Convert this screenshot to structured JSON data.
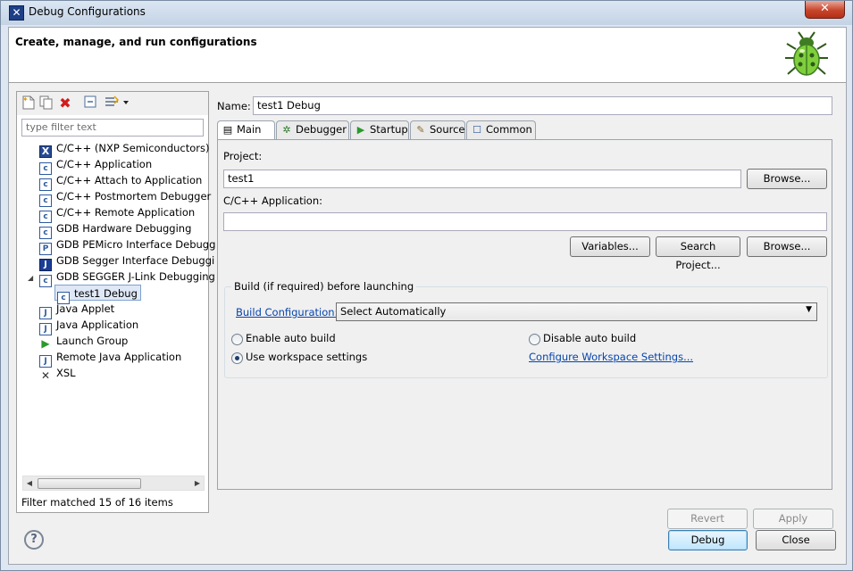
{
  "window": {
    "title": "Debug Configurations",
    "close_glyph": "✕"
  },
  "header": {
    "title": "Create, manage, and run configurations"
  },
  "left_panel": {
    "toolbar_icons": [
      "new-configuration-icon",
      "duplicate-icon",
      "delete-icon",
      "collapse-all-icon",
      "filter-icon"
    ],
    "filter_placeholder": "type filter text",
    "tree": [
      {
        "label": "C/C++ (NXP Semiconductors)",
        "icon": "X",
        "level": 0
      },
      {
        "label": "C/C++ Application",
        "icon": "c",
        "level": 0
      },
      {
        "label": "C/C++ Attach to Application",
        "icon": "c",
        "level": 0
      },
      {
        "label": "C/C++ Postmortem Debugger",
        "icon": "c",
        "level": 0
      },
      {
        "label": "C/C++ Remote Application",
        "icon": "c",
        "level": 0
      },
      {
        "label": "GDB Hardware Debugging",
        "icon": "c",
        "level": 0
      },
      {
        "label": "GDB PEMicro Interface Debugg",
        "icon": "P",
        "level": 0
      },
      {
        "label": "GDB Segger Interface Debuggi",
        "icon": "J",
        "level": 0
      },
      {
        "label": "GDB SEGGER J-Link Debugging",
        "icon": "c",
        "level": 0,
        "expanded": true
      },
      {
        "label": "test1 Debug",
        "icon": "c",
        "level": 1,
        "selected": true
      },
      {
        "label": "Java Applet",
        "icon": "J",
        "level": 0
      },
      {
        "label": "Java Application",
        "icon": "J",
        "level": 0
      },
      {
        "label": "Launch Group",
        "icon": "▶",
        "level": 0
      },
      {
        "label": "Remote Java Application",
        "icon": "J",
        "level": 0
      },
      {
        "label": "XSL",
        "icon": "✕",
        "level": 0
      }
    ],
    "expand_glyph": "◢",
    "status": "Filter matched 15 of 16 items",
    "scroll_left": "◀",
    "scroll_right": "▶"
  },
  "config": {
    "name_label": "Name:",
    "name_value": "test1 Debug",
    "tabs": [
      {
        "label": "Main",
        "icon": "▤"
      },
      {
        "label": "Debugger",
        "icon": "✲"
      },
      {
        "label": "Startup",
        "icon": "▶"
      },
      {
        "label": "Source",
        "icon": "✎"
      },
      {
        "label": "Common",
        "icon": "☐"
      }
    ],
    "project_label": "Project:",
    "project_value": "test1",
    "browse_label": "Browse...",
    "app_label": "C/C++ Application:",
    "app_value": "",
    "variables_label": "Variables...",
    "search_project_label": "Search Project...",
    "browse2_label": "Browse...",
    "build_group_title": "Build (if required) before launching",
    "build_config_link": "Build Configuration:",
    "build_config_value": "Select Automatically",
    "dropdown_caret": "▼",
    "enable_auto_build": "Enable auto build",
    "disable_auto_build": "Disable auto build",
    "use_workspace_settings": "Use workspace settings",
    "configure_workspace_link": "Configure Workspace Settings...",
    "revert_label": "Revert",
    "apply_label": "Apply"
  },
  "footer": {
    "help_glyph": "?",
    "debug_label": "Debug",
    "close_label": "Close"
  }
}
